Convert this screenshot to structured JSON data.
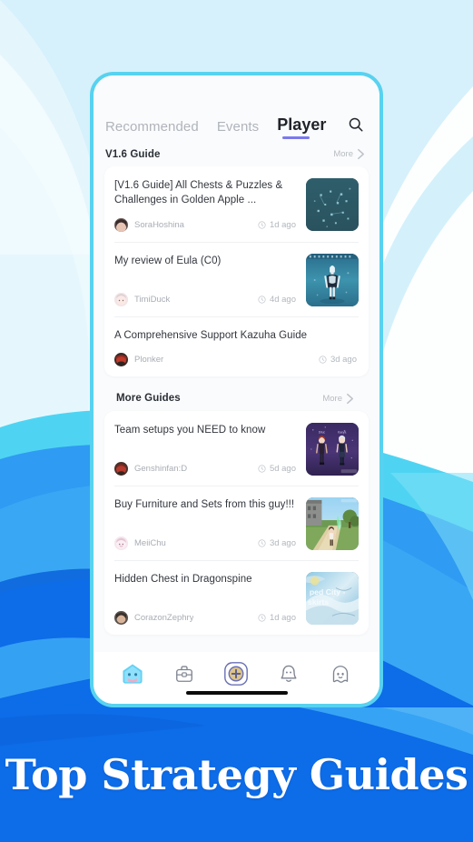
{
  "background": {
    "base_color": "#d6f1fb",
    "wave_colors": [
      "#ffffff",
      "#cbeefb",
      "#4ed4f2",
      "#2f9bf2",
      "#0d6ce8",
      "#0b5fd6"
    ]
  },
  "phone": {
    "border_color": "#58d2f0",
    "screen_bg": "#fafbfc"
  },
  "tabs": [
    {
      "label": "Recommended",
      "active": false
    },
    {
      "label": "Events",
      "active": false
    },
    {
      "label": "Player",
      "active": true
    }
  ],
  "search": {
    "icon": "search-icon"
  },
  "accent": {
    "tab_underline": "#7b78ee"
  },
  "sections": [
    {
      "title": "V1.6 Guide",
      "more_label": "More",
      "items": [
        {
          "title": "[V1.6 Guide] All Chests & Puzzles & Challenges in Golden Apple ...",
          "author": "SoraHoshina",
          "time": "1d ago",
          "thumb": "underwater-chests",
          "two_line": true
        },
        {
          "title": "My review of Eula (C0)",
          "author": "TimiDuck",
          "time": "4d ago",
          "thumb": "eula-character",
          "two_line": true
        },
        {
          "title": "A Comprehensive Support Kazuha Guide",
          "author": "Plonker",
          "time": "3d ago",
          "thumb": null,
          "two_line": false
        }
      ]
    },
    {
      "title": "More Guides",
      "more_label": "More",
      "items": [
        {
          "title": "Team setups you NEED to know",
          "author": "Genshinfan:D",
          "time": "5d ago",
          "thumb": "team-setup-purple",
          "two_line": true
        },
        {
          "title": "Buy Furniture and Sets from this guy!!!",
          "author": "MeiiChu",
          "time": "3d ago",
          "thumb": "furniture-outdoor",
          "two_line": true
        },
        {
          "title": "Hidden Chest in Dragonspine",
          "author": "CorazonZephry",
          "time": "1d ago",
          "thumb": "dragonspine-snow",
          "thumb_overlay_lines": [
            "ped City -",
            "skirts"
          ],
          "two_line": true
        }
      ]
    }
  ],
  "bottom_nav": [
    {
      "icon": "home-slime-icon",
      "active": true
    },
    {
      "icon": "backpack-icon",
      "active": false
    },
    {
      "icon": "add-post-icon",
      "active": false
    },
    {
      "icon": "notification-bell-icon",
      "active": false
    },
    {
      "icon": "profile-ghost-icon",
      "active": false
    }
  ],
  "home_indicator": {
    "visible": true
  },
  "banner": {
    "text": "Top Strategy Guides",
    "bg_color": "#0d6ce8",
    "text_color": "#ffffff"
  }
}
